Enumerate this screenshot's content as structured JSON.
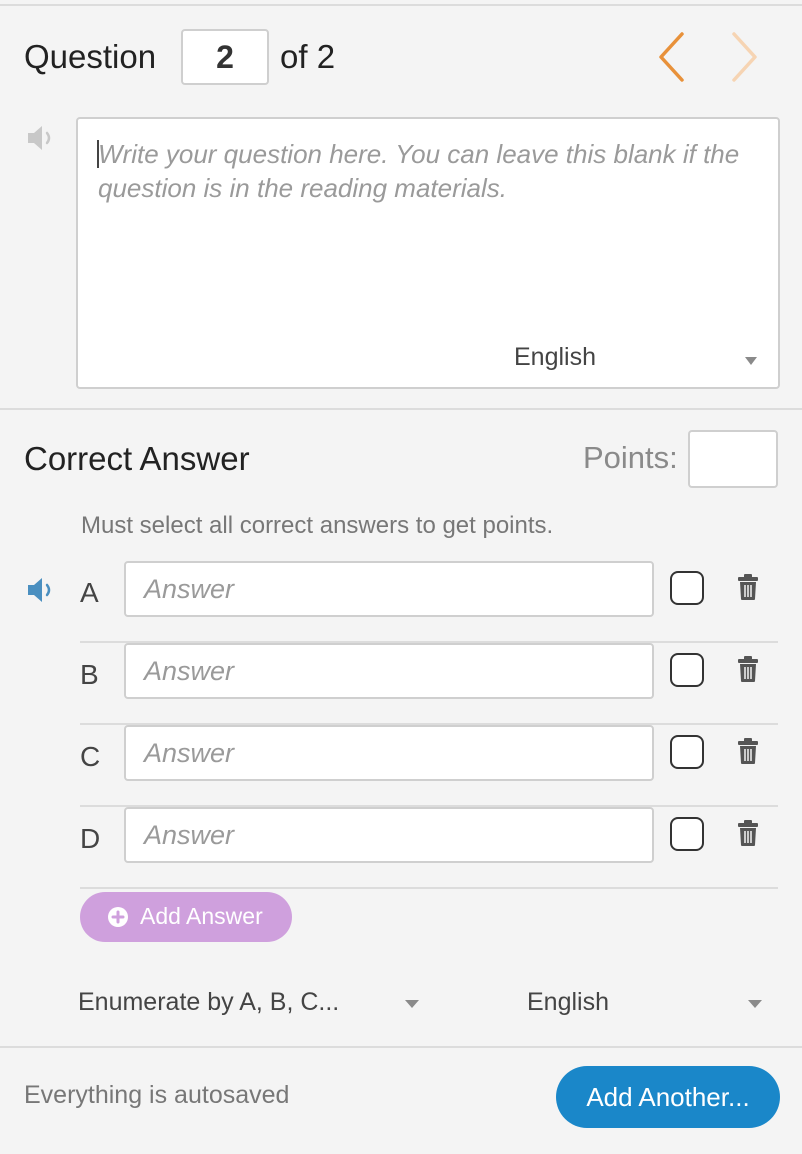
{
  "header": {
    "question_label": "Question",
    "question_number": "2",
    "of_total": "of 2",
    "prev_icon": "chevron-left-icon",
    "next_icon": "chevron-right-icon",
    "accent_color": "#e8913a"
  },
  "question": {
    "placeholder": "Write your question here. You can leave this blank if the question is in the reading materials.",
    "language": "English"
  },
  "correct_answer": {
    "title": "Correct Answer",
    "points_label": "Points:",
    "points_value": "",
    "instruction": "Must select all correct answers to get points.",
    "answers": [
      {
        "letter": "A",
        "placeholder": "Answer",
        "checked": false
      },
      {
        "letter": "B",
        "placeholder": "Answer",
        "checked": false
      },
      {
        "letter": "C",
        "placeholder": "Answer",
        "checked": false
      },
      {
        "letter": "D",
        "placeholder": "Answer",
        "checked": false
      }
    ],
    "add_answer_label": "Add Answer",
    "add_answer_color": "#cfa0dd"
  },
  "options": {
    "enumerate_label": "Enumerate by A, B, C...",
    "language": "English"
  },
  "footer": {
    "autosave_text": "Everything is autosaved",
    "add_another_label": "Add Another...",
    "add_another_color": "#1a87c9"
  }
}
